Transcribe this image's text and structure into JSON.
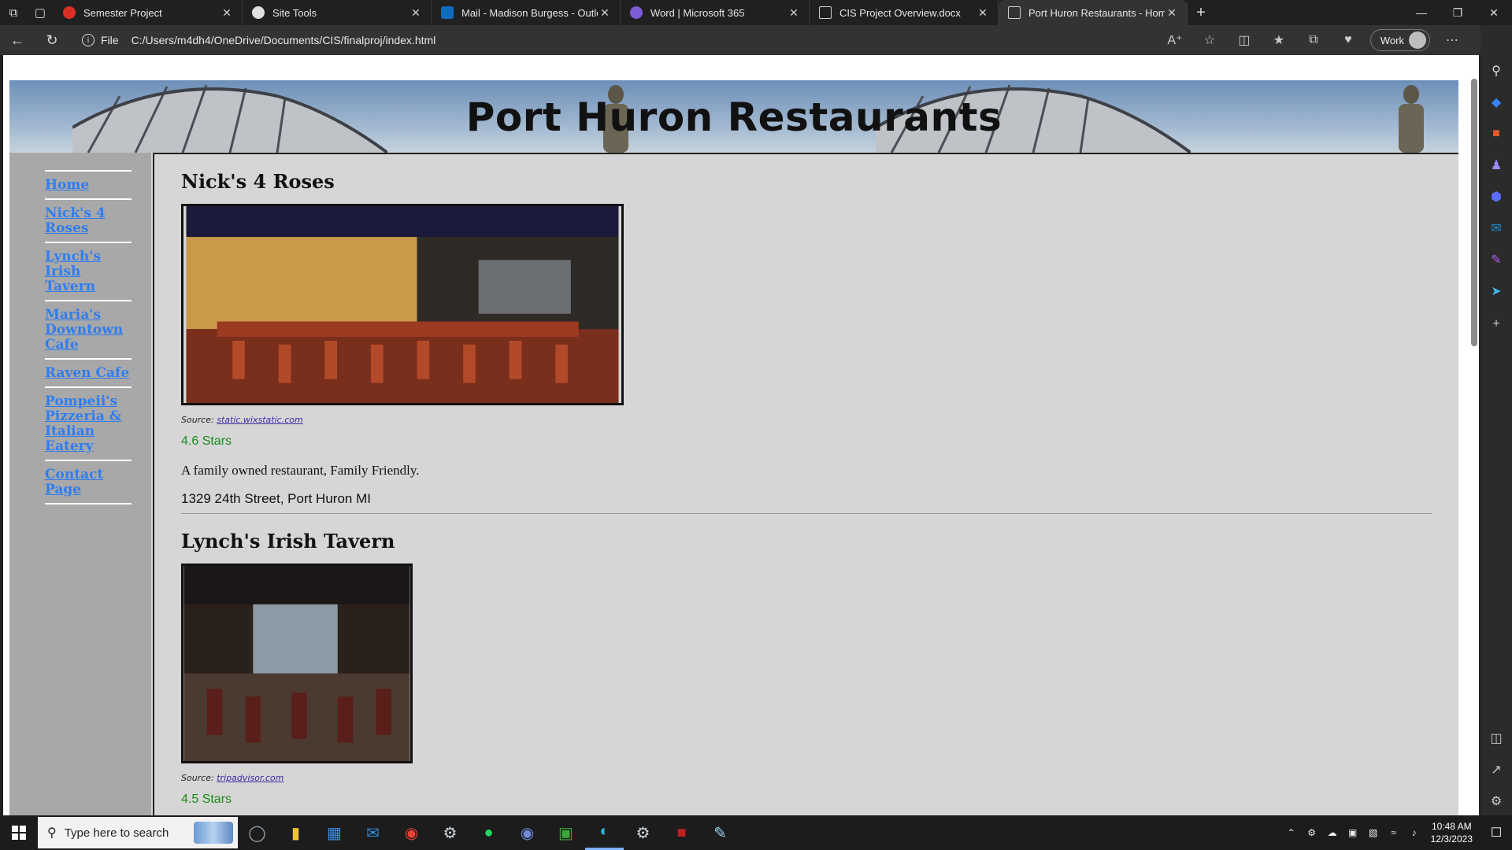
{
  "browser": {
    "tabs": [
      {
        "title": "Semester Project",
        "favicon_color": "#d93025"
      },
      {
        "title": "Site Tools",
        "favicon_color": "#e0e0e0"
      },
      {
        "title": "Mail - Madison Burgess - Outloo",
        "favicon_color": "#0f6cbd"
      },
      {
        "title": "Word | Microsoft 365",
        "favicon_color": "#7b5cd6"
      },
      {
        "title": "CIS Project Overview.docx",
        "favicon_color": "#cfcfcf"
      },
      {
        "title": "Port Huron Restaurants - Home F",
        "favicon_color": "#cfcfcf"
      }
    ],
    "address": {
      "scheme_label": "File",
      "url": "C:/Users/m4dh4/OneDrive/Documents/CIS/finalproj/index.html"
    },
    "profile_label": "Work"
  },
  "site": {
    "title": "Port Huron Restaurants",
    "nav": [
      {
        "label": "Home"
      },
      {
        "label": "Nick's 4 Roses"
      },
      {
        "label": "Lynch's Irish Tavern"
      },
      {
        "label": "Maria's Downtown Cafe"
      },
      {
        "label": "Raven Cafe"
      },
      {
        "label": "Pompeii's Pizzeria & Italian Eatery"
      },
      {
        "label": "Contact Page"
      }
    ],
    "restaurants": [
      {
        "name": "Nick's 4 Roses",
        "source_label": "Source:",
        "source_link": "static.wixstatic.com",
        "rating": "4.6 Stars",
        "description": "A family owned restaurant, Family Friendly.",
        "address": "1329 24th Street, Port Huron MI"
      },
      {
        "name": "Lynch's Irish Tavern",
        "source_label": "Source:",
        "source_link": "tripadvisor.com",
        "rating": "4.5 Stars"
      }
    ]
  },
  "taskbar": {
    "search_placeholder": "Type here to search",
    "time": "10:48 AM",
    "date": "12/3/2023"
  }
}
